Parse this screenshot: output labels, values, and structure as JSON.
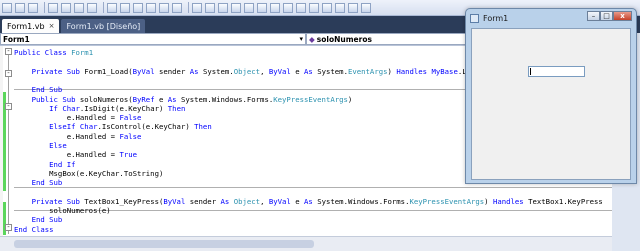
{
  "tabs": [
    {
      "label": "Form1.vb",
      "close": "×",
      "active": true
    },
    {
      "label": "Form1.vb [Diseño]",
      "active": false
    }
  ],
  "nav": {
    "class_combo": "Form1",
    "member_combo": "soloNumeros",
    "combo_arrow": "▾",
    "member_icon": "◆"
  },
  "code_lines": [
    {
      "tokens": [
        {
          "t": "Public Class ",
          "c": "kw"
        },
        {
          "t": "Form1",
          "c": "ty"
        }
      ]
    },
    {
      "tokens": []
    },
    {
      "tokens": [
        {
          "t": "    Private Sub ",
          "c": "kw"
        },
        {
          "t": "Form1_Load("
        },
        {
          "t": "ByVal",
          "c": "kw"
        },
        {
          "t": " sender "
        },
        {
          "t": "As",
          "c": "kw"
        },
        {
          "t": " System."
        },
        {
          "t": "Object",
          "c": "ty"
        },
        {
          "t": ", "
        },
        {
          "t": "ByVal",
          "c": "kw"
        },
        {
          "t": " e "
        },
        {
          "t": "As",
          "c": "kw"
        },
        {
          "t": " System."
        },
        {
          "t": "EventArgs",
          "c": "ty"
        },
        {
          "t": ") "
        },
        {
          "t": "Handles",
          "c": "kw"
        },
        {
          "t": " "
        },
        {
          "t": "MyBase",
          "c": "kw"
        },
        {
          "t": ".Load"
        }
      ]
    },
    {
      "tokens": []
    },
    {
      "tokens": [
        {
          "t": "    End Sub",
          "c": "kw"
        }
      ]
    },
    {
      "tokens": [
        {
          "t": "    Public Sub ",
          "c": "kw"
        },
        {
          "t": "soloNumeros("
        },
        {
          "t": "ByRef",
          "c": "kw"
        },
        {
          "t": " e "
        },
        {
          "t": "As",
          "c": "kw"
        },
        {
          "t": " System.Windows.Forms."
        },
        {
          "t": "KeyPressEventArgs",
          "c": "ty"
        },
        {
          "t": ")"
        }
      ]
    },
    {
      "tokens": [
        {
          "t": "        If ",
          "c": "kw"
        },
        {
          "t": "Char",
          "c": "kw"
        },
        {
          "t": ".IsDigit(e.KeyChar) "
        },
        {
          "t": "Then",
          "c": "kw"
        }
      ]
    },
    {
      "tokens": [
        {
          "t": "            e.Handled = "
        },
        {
          "t": "False",
          "c": "kw"
        }
      ]
    },
    {
      "tokens": [
        {
          "t": "        ElseIf ",
          "c": "kw"
        },
        {
          "t": "Char",
          "c": "kw"
        },
        {
          "t": ".IsControl(e.KeyChar) "
        },
        {
          "t": "Then",
          "c": "kw"
        }
      ]
    },
    {
      "tokens": [
        {
          "t": "            e.Handled = "
        },
        {
          "t": "False",
          "c": "kw"
        }
      ]
    },
    {
      "tokens": [
        {
          "t": "        Else",
          "c": "kw"
        }
      ]
    },
    {
      "tokens": [
        {
          "t": "            e.Handled = "
        },
        {
          "t": "True",
          "c": "kw"
        }
      ]
    },
    {
      "tokens": [
        {
          "t": "        End If",
          "c": "kw"
        }
      ]
    },
    {
      "tokens": [
        {
          "t": "        MsgBox(e.KeyChar.ToString)"
        }
      ]
    },
    {
      "tokens": [
        {
          "t": "    End Sub",
          "c": "kw"
        }
      ]
    },
    {
      "tokens": []
    },
    {
      "tokens": [
        {
          "t": "    Private Sub ",
          "c": "kw"
        },
        {
          "t": "TextBox1_KeyPress("
        },
        {
          "t": "ByVal",
          "c": "kw"
        },
        {
          "t": " sender "
        },
        {
          "t": "As",
          "c": "kw"
        },
        {
          "t": " "
        },
        {
          "t": "Object",
          "c": "ty"
        },
        {
          "t": ", "
        },
        {
          "t": "ByVal",
          "c": "kw"
        },
        {
          "t": " e "
        },
        {
          "t": "As",
          "c": "kw"
        },
        {
          "t": " System.Windows.Forms."
        },
        {
          "t": "KeyPressEventArgs",
          "c": "ty"
        },
        {
          "t": ") "
        },
        {
          "t": "Handles",
          "c": "kw"
        },
        {
          "t": " TextBox1.KeyPress"
        }
      ]
    },
    {
      "tokens": [
        {
          "t": "        soloNumeros(e)"
        }
      ]
    },
    {
      "tokens": [
        {
          "t": "    End Sub",
          "c": "kw"
        }
      ]
    },
    {
      "tokens": [
        {
          "t": "End Class",
          "c": "kw"
        }
      ]
    }
  ],
  "form_window": {
    "title": "Form1",
    "minimize": "–",
    "maximize": "□",
    "close": "x",
    "textbox_value": ""
  },
  "colors": {
    "keyword": "#0000ff",
    "type": "#2b91af",
    "change_marker": "#5bd65b"
  }
}
